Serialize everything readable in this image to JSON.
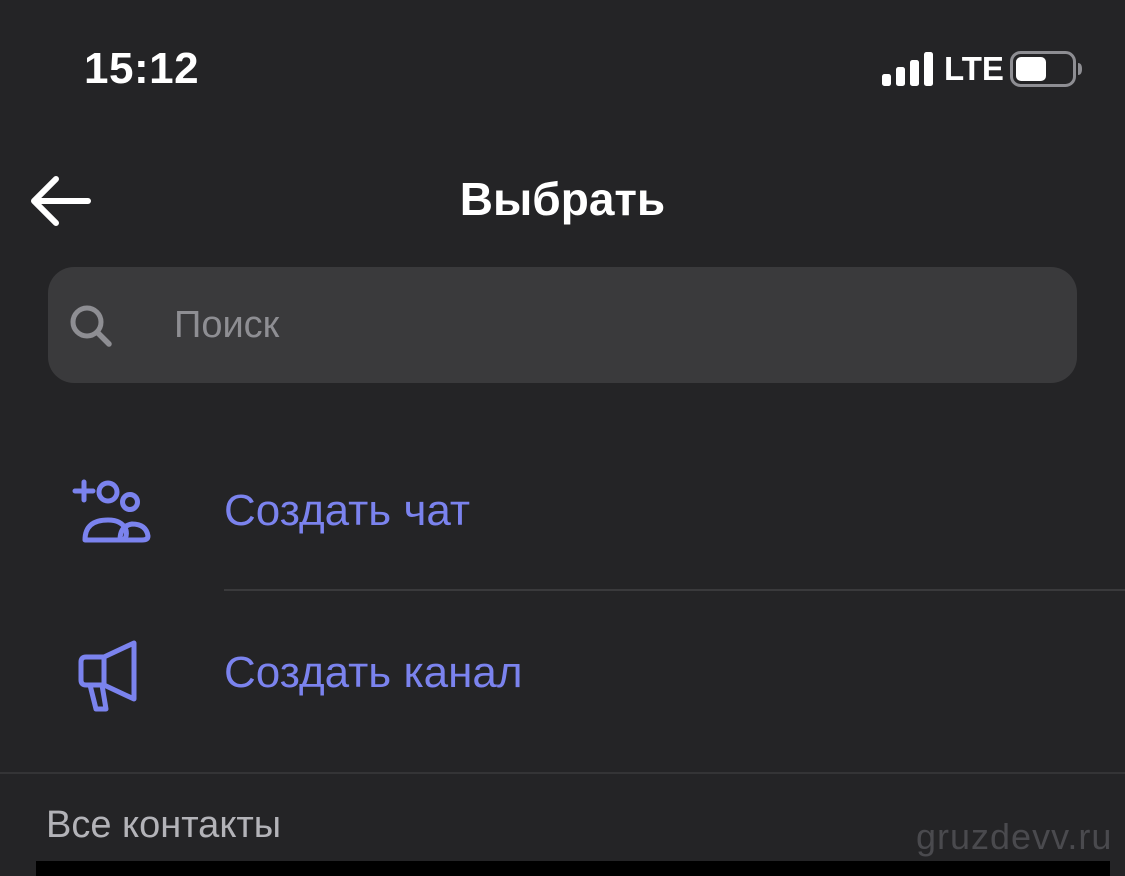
{
  "status_bar": {
    "time": "15:12",
    "network": "LTE",
    "signal_icon": "cellular-signal-icon",
    "battery_icon": "battery-icon"
  },
  "nav": {
    "title": "Выбрать",
    "back_icon": "arrow-left-icon"
  },
  "search": {
    "placeholder": "Поиск",
    "value": "",
    "icon": "search-icon"
  },
  "actions": [
    {
      "label": "Создать чат",
      "icon": "add-group-icon"
    },
    {
      "label": "Создать канал",
      "icon": "megaphone-icon"
    }
  ],
  "section": {
    "title": "Все контакты"
  },
  "watermark": "gruzdevv.ru",
  "colors": {
    "background": "#242426",
    "accent": "#7b83ee",
    "search_bg": "#3a3a3c",
    "placeholder": "#8e8e93",
    "section_text": "#b3b3b8"
  }
}
